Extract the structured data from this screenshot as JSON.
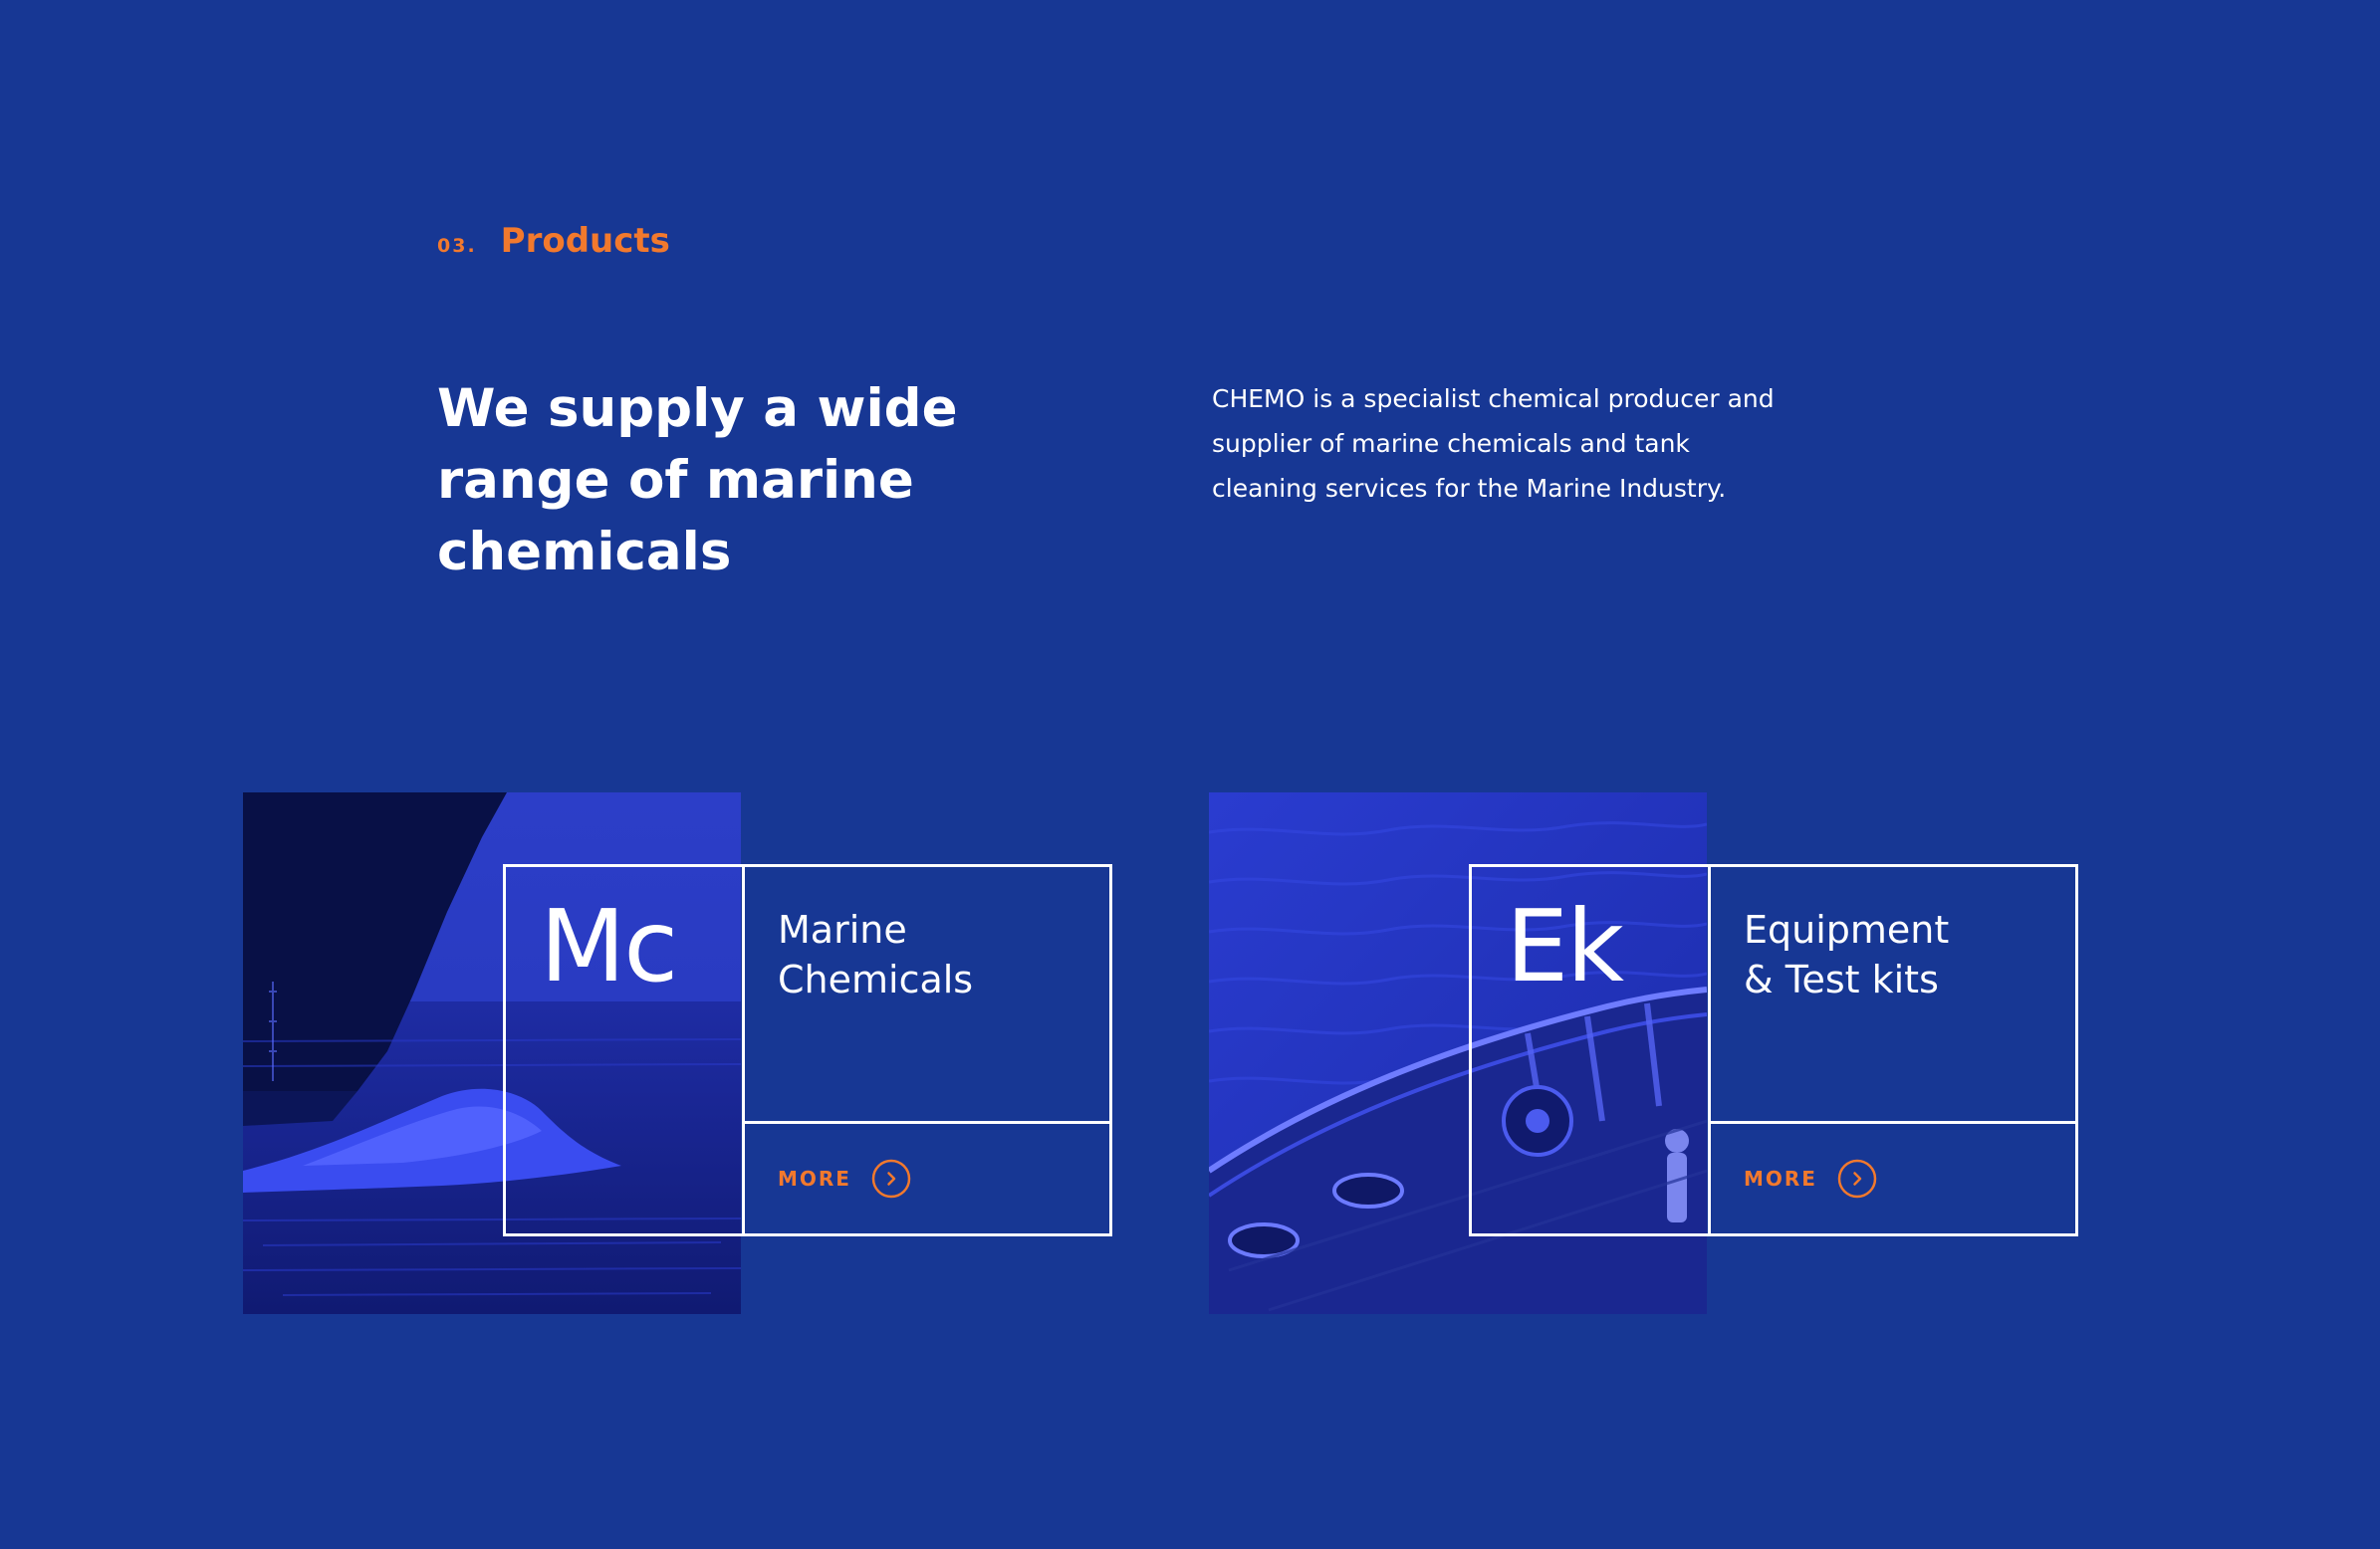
{
  "section": {
    "number": "03.",
    "title": "Products"
  },
  "headline": "We supply a wide range of marine chemicals",
  "intro": "CHEMO is a specialist chemical producer and supplier of marine chemicals and tank cleaning services for the Marine Industry.",
  "products": [
    {
      "symbol": "Mc",
      "name_lines": [
        "Marine",
        "Chemicals"
      ],
      "more_label": "MORE",
      "more_icon": "chevron-right-circle-icon"
    },
    {
      "symbol": "Ek",
      "name_lines": [
        "Equipment",
        "& Test kits"
      ],
      "more_label": "MORE",
      "more_icon": "chevron-right-circle-icon"
    }
  ],
  "colors": {
    "background": "#173794",
    "accent": "#f2792d",
    "text": "#ffffff",
    "photo_tint": "#2a3fd6"
  }
}
